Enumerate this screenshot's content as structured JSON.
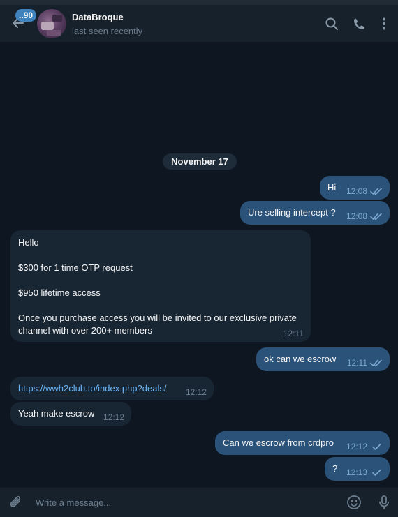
{
  "header": {
    "unread_badge": "..90",
    "contact_name": "DataBroque",
    "status": "last seen recently",
    "icons": [
      "back-arrow-icon",
      "search-icon",
      "phone-icon",
      "more-vertical-icon"
    ]
  },
  "date_separator": "November 17",
  "messages": [
    {
      "dir": "out",
      "text": "Hi",
      "time": "12:08",
      "status": "read"
    },
    {
      "dir": "out",
      "text": "Ure selling intercept ?",
      "time": "12:08",
      "status": "read"
    },
    {
      "dir": "in",
      "text": "Hello\n\n$300 for 1 time OTP request\n\n$950 lifetime access\n\nOnce you purchase access you will be invited to our exclusive private channel with over 200+ members",
      "time": "12:11"
    },
    {
      "dir": "out",
      "text": "ok can we escrow",
      "time": "12:11",
      "status": "read"
    },
    {
      "dir": "in",
      "text": "https://wwh2club.to/index.php?deals/",
      "time": "12:12",
      "is_link": true
    },
    {
      "dir": "in",
      "text": "Yeah make escrow",
      "time": "12:12"
    },
    {
      "dir": "out",
      "text": "Can we escrow from crdpro",
      "time": "12:12",
      "status": "sent"
    },
    {
      "dir": "out",
      "text": "?",
      "time": "12:13",
      "status": "sent"
    }
  ],
  "composer": {
    "placeholder": "Write a message...",
    "icons": [
      "paperclip-icon",
      "emoji-icon",
      "microphone-icon"
    ]
  },
  "colors": {
    "background": "#0e1621",
    "header": "#17212b",
    "outgoing_bubble": "#2b5278",
    "incoming_bubble": "#182533",
    "link": "#6ab3f3",
    "badge": "#4082bc"
  }
}
